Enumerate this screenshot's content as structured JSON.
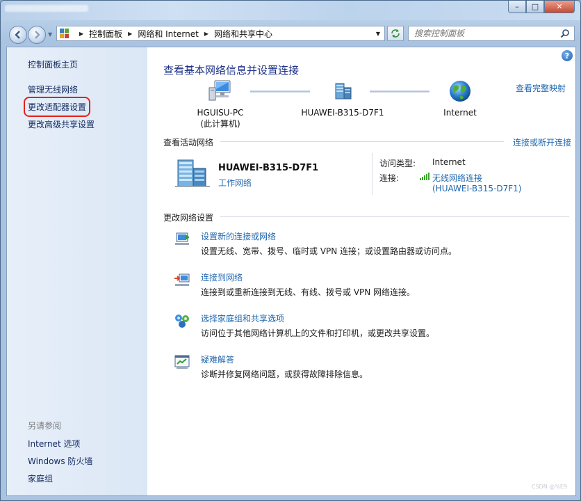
{
  "window": {
    "controls": {
      "minimize": "–",
      "maximize": "□",
      "close": "✕"
    }
  },
  "address_bar": {
    "crumbs": [
      "控制面板",
      "网络和 Internet",
      "网络和共享中心"
    ],
    "search_placeholder": "搜索控制面板"
  },
  "sidebar": {
    "items": [
      {
        "label": "控制面板主页"
      },
      {
        "label": "管理无线网络"
      },
      {
        "label": "更改适配器设置",
        "highlighted": true
      },
      {
        "label": "更改高级共享设置"
      }
    ],
    "see_also_heading": "另请参阅",
    "see_also": [
      {
        "label": "Internet 选项"
      },
      {
        "label": "Windows 防火墙"
      },
      {
        "label": "家庭组"
      }
    ]
  },
  "main": {
    "title": "查看基本网络信息并设置连接",
    "full_map_link": "查看完整映射",
    "network_map": {
      "computer": {
        "name": "HGUISU-PC",
        "note": "(此计算机)",
        "icon": "computer-icon"
      },
      "network": {
        "name": "HUAWEI-B315-D7F1",
        "icon": "network-icon"
      },
      "internet": {
        "name": "Internet",
        "icon": "globe-icon"
      }
    },
    "active_networks": {
      "heading": "查看活动网络",
      "disconnect_link": "连接或断开连接",
      "network_name": "HUAWEI-B315-D7F1",
      "network_type": "工作网络",
      "access_type_label": "访问类型:",
      "access_type_value": "Internet",
      "connections_label": "连接:",
      "connection_name": "无线网络连接",
      "connection_ssid": "(HUAWEI-B315-D7F1)"
    },
    "change_settings": {
      "heading": "更改网络设置",
      "tasks": [
        {
          "title": "设置新的连接或网络",
          "desc": "设置无线、宽带、拨号、临时或 VPN 连接；或设置路由器或访问点。",
          "icon": "new-connection-icon"
        },
        {
          "title": "连接到网络",
          "desc": "连接到或重新连接到无线、有线、拨号或 VPN 网络连接。",
          "icon": "connect-network-icon"
        },
        {
          "title": "选择家庭组和共享选项",
          "desc": "访问位于其他网络计算机上的文件和打印机，或更改共享设置。",
          "icon": "homegroup-icon"
        },
        {
          "title": "疑难解答",
          "desc": "诊断并修复网络问题，或获得故障排除信息。",
          "icon": "troubleshoot-icon"
        }
      ]
    }
  },
  "watermark": "CSDN @%E9",
  "colors": {
    "link": "#1f67b0",
    "title": "#1e3287",
    "highlight": "#e3231b"
  }
}
